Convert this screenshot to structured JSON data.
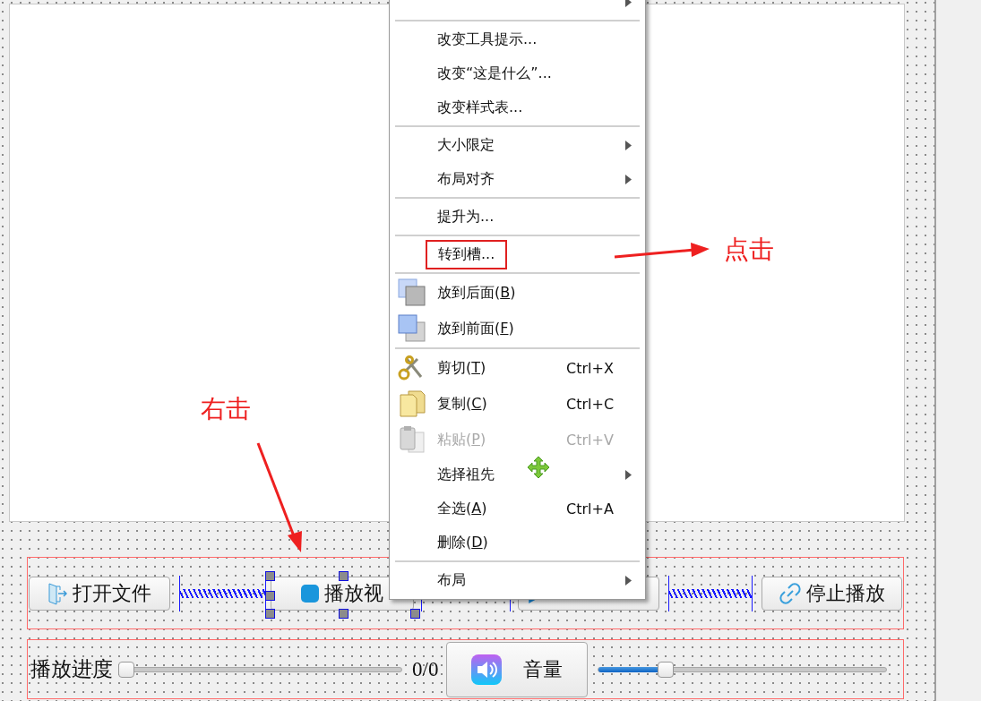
{
  "form": {
    "buttons": [
      {
        "label": "打开文件",
        "kind": "open",
        "selected": false
      },
      {
        "label": "播放视",
        "kind": "play",
        "selected": true
      },
      {
        "kind": "pause",
        "selected": false
      },
      {
        "label": "停止播放",
        "kind": "stop",
        "selected": false
      }
    ],
    "progress": {
      "label": "播放进度",
      "level": 0,
      "reading": "0/0"
    },
    "volume": {
      "label": "音量",
      "level": 0.22
    }
  },
  "menu": {
    "groups": [
      [
        {
          "kind": "plain",
          "submenu": true,
          "disabled": false
        }
      ],
      [
        {
          "label": "改变工具提示...",
          "kind": "plain",
          "submenu": false,
          "disabled": false
        },
        {
          "label": "改变“这是什么”...",
          "kind": "plain",
          "submenu": false,
          "disabled": false
        },
        {
          "label": "改变样式表...",
          "kind": "plain",
          "submenu": false,
          "disabled": false
        }
      ],
      [
        {
          "label": "大小限定",
          "kind": "plain",
          "submenu": true,
          "disabled": false
        },
        {
          "label": "布局对齐",
          "kind": "plain",
          "submenu": true,
          "disabled": false
        }
      ],
      [
        {
          "label": "提升为...",
          "kind": "plain",
          "submenu": false,
          "disabled": false
        }
      ],
      [
        {
          "label": "转到槽...",
          "kind": "plain",
          "submenu": false,
          "disabled": false,
          "boxed": true
        }
      ],
      [
        {
          "label": "放到后面(B)",
          "kind": "back",
          "submenu": false,
          "disabled": false,
          "mnemonic": true
        },
        {
          "label": "放到前面(F)",
          "kind": "front",
          "submenu": false,
          "disabled": false,
          "mnemonic": true
        }
      ],
      [
        {
          "label": "剪切(T)",
          "kind": "cut",
          "shortcut": "Ctrl+X",
          "submenu": false,
          "disabled": false,
          "mnemonic": true
        },
        {
          "label": "复制(C)",
          "kind": "copy",
          "shortcut": "Ctrl+C",
          "submenu": false,
          "disabled": false,
          "mnemonic": true
        },
        {
          "label": "粘贴(P)",
          "kind": "paste",
          "shortcut": "Ctrl+V",
          "submenu": false,
          "disabled": true,
          "mnemonic": true
        },
        {
          "label": "选择祖先",
          "kind": "plain",
          "submenu": true,
          "disabled": false
        },
        {
          "label": "全选(A)",
          "kind": "plain",
          "shortcut": "Ctrl+A",
          "submenu": false,
          "disabled": false,
          "mnemonic": true
        },
        {
          "label": "删除(D)",
          "kind": "plain",
          "submenu": false,
          "disabled": false,
          "mnemonic": true
        }
      ],
      [
        {
          "label": "布局",
          "kind": "plain",
          "submenu": true,
          "disabled": false
        }
      ]
    ]
  },
  "annotations": [
    {
      "text": "右击"
    },
    {
      "text": "点击"
    }
  ]
}
